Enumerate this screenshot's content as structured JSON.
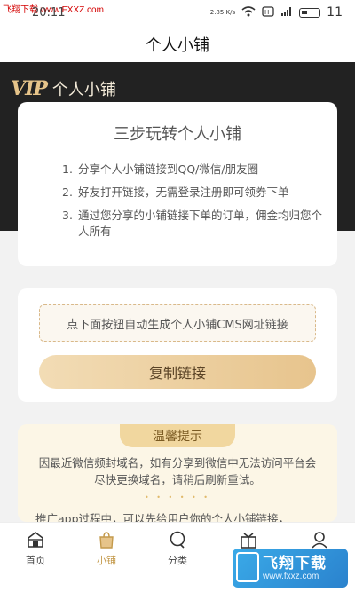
{
  "status_bar": {
    "watermark": "飞翔下载 www.FXXZ.com",
    "time": "20:11",
    "net_speed": "2.85 K/s",
    "battery": "11"
  },
  "header": {
    "title": "个人小铺"
  },
  "hero": {
    "vip": "VIP",
    "title": "个人小铺"
  },
  "steps_card": {
    "title": "三步玩转个人小铺",
    "steps": [
      {
        "num": "1.",
        "text": "分享个人小铺链接到QQ/微信/朋友圈"
      },
      {
        "num": "2.",
        "text": "好友打开链接，无需登录注册即可领券下单"
      },
      {
        "num": "3.",
        "text": "通过您分享的小铺链接下单的订单，佣金均归您个人所有"
      }
    ]
  },
  "link_card": {
    "hint": "点下面按钮自动生成个人小铺CMS网址链接",
    "copy_button": "复制链接"
  },
  "tips_card": {
    "title": "温馨提示",
    "p1": "因最近微信频封域名，如有分享到微信中无法访问平台会尽快更换域名，请稍后刷新重试。",
    "dots": "• • • • • •",
    "p2": "推广app过程中，可以先给用户你的个人小铺链接，"
  },
  "bottom_nav": [
    {
      "label": "首页",
      "icon": "home-icon"
    },
    {
      "label": "小铺",
      "icon": "shop-bag-icon"
    },
    {
      "label": "分类",
      "icon": "category-chat-icon"
    },
    {
      "label": "",
      "icon": "gift-icon"
    },
    {
      "label": "",
      "icon": "user-icon"
    }
  ],
  "download_badge": {
    "text": "飞翔下载",
    "url": "www.fxxz.com"
  },
  "colors": {
    "hero_bg": "#222222",
    "gold": "#e6c48a",
    "button_gradient_start": "#f2dcb5",
    "button_gradient_end": "#e7c48d",
    "active_nav": "#c49a4c",
    "tips_bg": "#fcf6e6"
  }
}
